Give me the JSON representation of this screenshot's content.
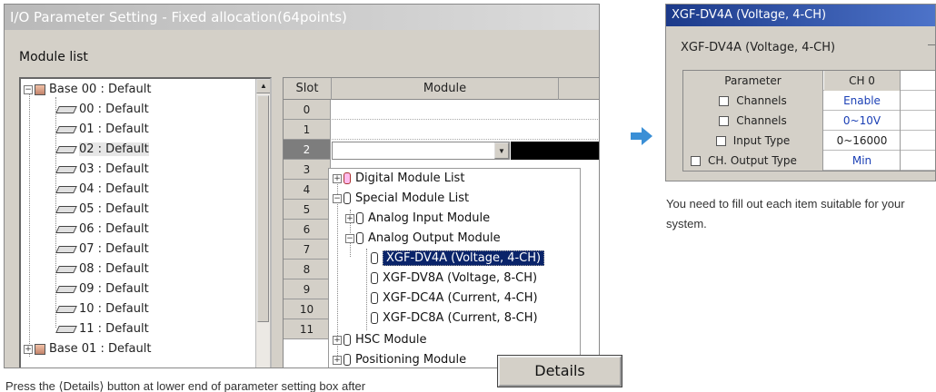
{
  "left_window": {
    "title": "I/O Parameter Setting - Fixed allocation(64points)",
    "module_list_label": "Module list",
    "tree": {
      "bases": [
        {
          "label": "Base 00 : Default",
          "expander": "−"
        },
        {
          "label": "Base 01 : Default",
          "expander": "+"
        }
      ],
      "slots": [
        "00 : Default",
        "01 : Default",
        "02 : Default",
        "03 : Default",
        "04 : Default",
        "05 : Default",
        "06 : Default",
        "07 : Default",
        "08 : Default",
        "09 : Default",
        "10 : Default",
        "11 : Default"
      ],
      "selected_slot": "02 : Default"
    },
    "grid": {
      "headers": [
        "Slot",
        "Module"
      ],
      "slots": [
        "0",
        "1",
        "2",
        "3",
        "4",
        "5",
        "6",
        "7",
        "8",
        "9",
        "10",
        "11"
      ],
      "active_slot": "2"
    },
    "dropdown": {
      "items": [
        {
          "label": "Digital Module List",
          "expander": "+"
        },
        {
          "label": "Special Module List",
          "expander": "−"
        },
        {
          "label": "Analog Input Module",
          "expander": "+"
        },
        {
          "label": "Analog Output Module",
          "expander": "−"
        },
        {
          "label": "XGF-DV4A (Voltage, 4-CH)",
          "selected": true
        },
        {
          "label": "XGF-DV8A (Voltage, 8-CH)"
        },
        {
          "label": "XGF-DC4A (Current, 4-CH)"
        },
        {
          "label": "XGF-DC8A (Current, 8-CH)"
        },
        {
          "label": "HSC Module",
          "expander": "+"
        },
        {
          "label": "Positioning Module",
          "expander": "+"
        }
      ]
    },
    "details_button": "Details",
    "caption": "Press the ⟨Details⟩ button at lower end of parameter setting box after"
  },
  "right_window": {
    "title": "XGF-DV4A (Voltage, 4-CH)",
    "module_name": "XGF-DV4A (Voltage, 4-CH)",
    "table": {
      "headers": [
        "Parameter",
        "CH 0"
      ],
      "rows": [
        {
          "param": "Channels",
          "value": "Enable"
        },
        {
          "param": "Channels",
          "value": "0~10V"
        },
        {
          "param": "Input Type",
          "value": "0~16000"
        },
        {
          "param": "CH. Output Type",
          "value": "Min"
        }
      ]
    },
    "caption": "You need to fill out each item suitable for your system."
  },
  "colors": {
    "accent_arrow": "#3a8fd6",
    "selected_item": "#0a246a",
    "value_blue": "#1a3fb5",
    "titlebar_blue": "#1c3a8a"
  }
}
